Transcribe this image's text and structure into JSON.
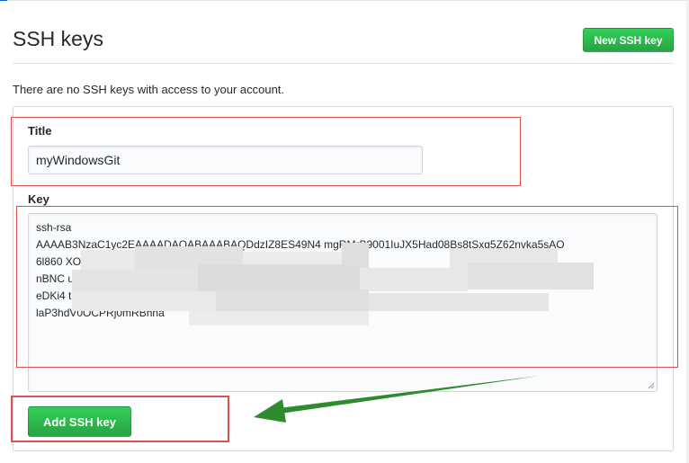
{
  "header": {
    "title": "SSH keys",
    "new_key_button": "New SSH key"
  },
  "notice": "There are no SSH keys with access to your account.",
  "form": {
    "title_label": "Title",
    "title_value": "myWindowsGit",
    "key_label": "Key",
    "key_lines": [
      "ssh-rsa",
      "AAAAB3NzaC1yc2EAAAADAQABAAABAQDdzIZ8ES49N4        mgRMrB9001IuJX5Had08Bs8tSxg5Z62nvka5sAO",
      "6l860                                                                      XO4CE                                             9soMoj52Tlb",
      "nBNC                                                                                                                           uv17OE",
      "eDKi4                                                                                                                     tn4RXI0CP",
      "laP3hdV0OCPRj0mRBhna"
    ],
    "add_button": "Add SSH key"
  },
  "colors": {
    "button_green": "#28a745",
    "annotation_red": "#d9534f",
    "annotation_arrow": "#2e8b2e"
  }
}
